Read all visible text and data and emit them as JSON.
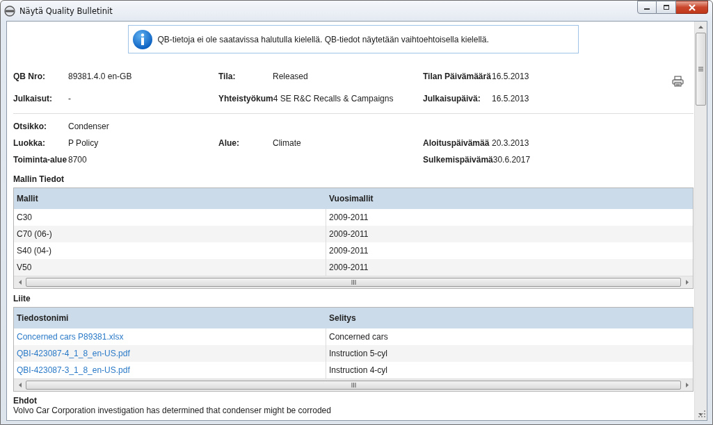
{
  "window": {
    "title": "Näytä Quality Bulletinit"
  },
  "notice": {
    "kind": "info",
    "text": "QB-tietoja ei ole saatavissa halutulla kielellä. QB-tiedot näytetään vaihtoehtoisella kielellä."
  },
  "header_fields": [
    {
      "left": {
        "label": "QB Nro:",
        "value": "89381.4.0 en-GB"
      },
      "middle": {
        "label": "Tila:",
        "value": "Released"
      },
      "right": {
        "label": "Tilan Päivämäärä",
        "value": "16.5.2013"
      }
    },
    {
      "left": {
        "label": "Julkaisut:",
        "value": "-"
      },
      "middle": {
        "label": "Yhteistyökum",
        "value": "4 SE R&C Recalls & Campaigns"
      },
      "right": {
        "label": "Julkaisupäivä:",
        "value": "16.5.2013"
      }
    }
  ],
  "detail_fields": [
    {
      "left": {
        "label": "Otsikko:",
        "value": "Condenser"
      }
    },
    {
      "left": {
        "label": "Luokka:",
        "value": "P  Policy"
      },
      "middle": {
        "label": "Alue:",
        "value": "Climate"
      },
      "right": {
        "label": "Aloituspäivämää",
        "value": "20.3.2013"
      }
    },
    {
      "left": {
        "label": "Toiminta-alue",
        "value": "8700"
      },
      "right": {
        "label": "Sulkemispäivämä",
        "value": "30.6.2017"
      }
    }
  ],
  "tables": [
    {
      "title": "Mallin Tiedot",
      "columns": [
        {
          "label": "Mallit",
          "kind": "text"
        },
        {
          "label": "Vuosimallit",
          "kind": "text"
        }
      ],
      "rows": [
        [
          "C30",
          "2009-2011"
        ],
        [
          "C70 (06-)",
          "2009-2011"
        ],
        [
          "S40 (04-)",
          "2009-2011"
        ],
        [
          "V50",
          "2009-2011"
        ]
      ]
    },
    {
      "title": "Liite",
      "columns": [
        {
          "label": "Tiedostonimi",
          "kind": "link"
        },
        {
          "label": "Selitys",
          "kind": "text"
        }
      ],
      "rows": [
        [
          "Concerned cars P89381.xlsx",
          "Concerned cars"
        ],
        [
          "QBI-423087-4_1_8_en-US.pdf",
          "Instruction 5-cyl"
        ],
        [
          "QBI-423087-3_1_8_en-US.pdf",
          "Instruction 4-cyl"
        ]
      ]
    }
  ],
  "conditions": {
    "title": "Ehdot",
    "text": "Volvo Car Corporation investigation has determined that condenser might be corroded"
  }
}
